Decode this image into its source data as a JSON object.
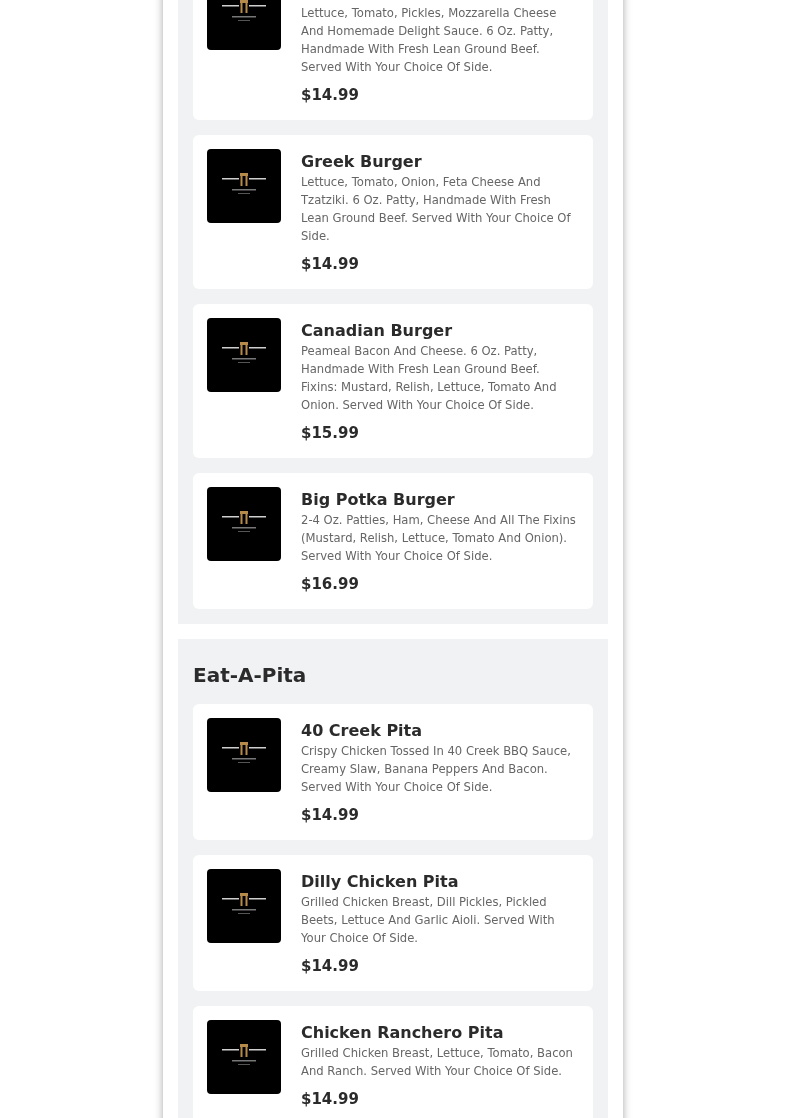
{
  "sections": [
    {
      "items": [
        {
          "description": "Lettuce, Tomato, Pickles, Mozzarella Cheese And Homemade Delight Sauce. 6 Oz. Patty, Handmade With Fresh Lean Ground Beef. Served With Your Choice Of Side.",
          "price": "$14.99"
        },
        {
          "name": "Greek Burger",
          "description": "Lettuce, Tomato, Onion, Feta Cheese And Tzatziki. 6 Oz. Patty, Handmade With Fresh Lean Ground Beef. Served With Your Choice Of Side.",
          "price": "$14.99"
        },
        {
          "name": "Canadian Burger",
          "description": "Peameal Bacon And Cheese. 6 Oz. Patty, Handmade With Fresh Lean Ground Beef. Fixins: Mustard, Relish, Lettuce, Tomato And Onion. Served With Your Choice Of Side.",
          "price": "$15.99"
        },
        {
          "name": "Big Potka Burger",
          "description": "2-4 Oz. Patties, Ham, Cheese And All The Fixins (Mustard, Relish, Lettuce, Tomato And Onion). Served With Your Choice Of Side.",
          "price": "$16.99"
        }
      ]
    },
    {
      "title": "Eat-A-Pita",
      "items": [
        {
          "name": "40 Creek Pita",
          "description": "Crispy Chicken Tossed In 40 Creek BBQ Sauce, Creamy Slaw, Banana Peppers And Bacon. Served With Your Choice Of Side.",
          "price": "$14.99"
        },
        {
          "name": "Dilly Chicken Pita",
          "description": "Grilled Chicken Breast, Dill Pickles, Pickled Beets, Lettuce And Garlic Aioli. Served With Your Choice Of Side.",
          "price": "$14.99"
        },
        {
          "name": "Chicken Ranchero Pita",
          "description": "Grilled Chicken Breast, Lettuce, Tomato, Bacon And Ranch. Served With Your Choice Of Side.",
          "price": "$14.99"
        }
      ]
    }
  ]
}
